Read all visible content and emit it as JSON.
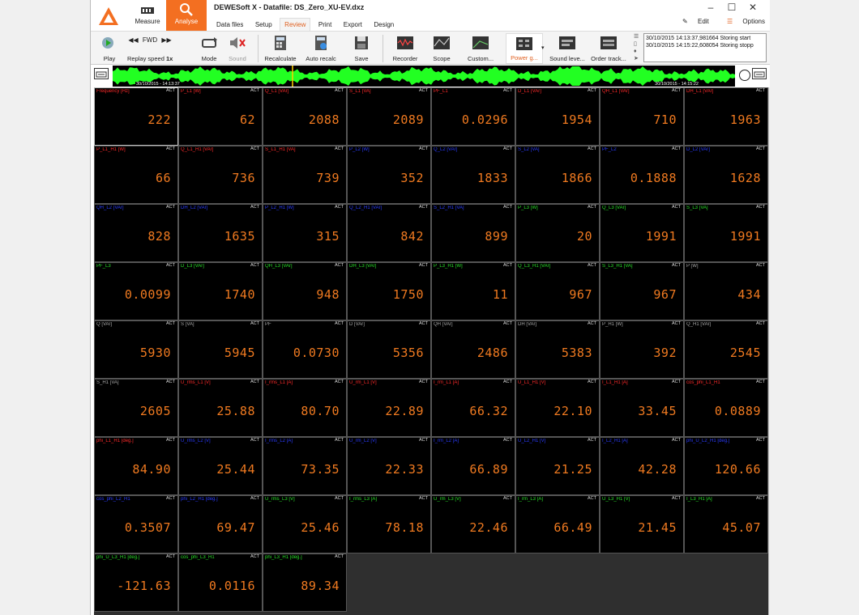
{
  "window": {
    "title": "DEWESoft X - Datafile: DS_Zero_XU-EV.dxz",
    "controls": [
      "–",
      "☐",
      "✕"
    ]
  },
  "modes": [
    {
      "label": "Measure"
    },
    {
      "label": "Analyse"
    }
  ],
  "menu_tabs": [
    "Data files",
    "Setup",
    "Review",
    "Print",
    "Export",
    "Design"
  ],
  "active_tab": "Review",
  "top_right": {
    "edit": "Edit",
    "options": "Options"
  },
  "toolbar": {
    "play": "Play",
    "fwd": "FWD",
    "replay_speed": "Replay speed",
    "replay_speed_value": "1x",
    "mode": "Mode",
    "sound": "Sound",
    "recalculate": "Recalculate",
    "auto_recalc": "Auto recalc",
    "save": "Save",
    "recorder": "Recorder",
    "scope": "Scope",
    "custom": "Custom...",
    "power": "Power g...",
    "sound_level": "Sound leve...",
    "order_tracking": "Order track..."
  },
  "event_log": [
    "30/10/2015 14:13:37,981664 Storing start",
    "30/10/2015 14:15:22,608054 Storing stopp"
  ],
  "overview": {
    "start": "30/10/2015 - 14:13:37",
    "end": "30/10/2015 - 14:15:22"
  },
  "colors": {
    "red": "#ff2a2a",
    "blue": "#2a3cff",
    "green": "#28e028",
    "gray": "#a8a8a8",
    "value": "#f07a20",
    "wave": "#22ff22"
  },
  "badge": "ACT",
  "cells": [
    {
      "name": "Frequency [Hz]",
      "value": "222",
      "color": "red"
    },
    {
      "name": "P_L1 [W]",
      "value": "62",
      "color": "red"
    },
    {
      "name": "Q_L1 [VAr]",
      "value": "2088",
      "color": "red"
    },
    {
      "name": "S_L1 [VA]",
      "value": "2089",
      "color": "red"
    },
    {
      "name": "PF_L1",
      "value": "0.0296",
      "color": "red"
    },
    {
      "name": "D_L1 [VAr]",
      "value": "1954",
      "color": "red"
    },
    {
      "name": "QH_L1 [VAr]",
      "value": "710",
      "color": "red"
    },
    {
      "name": "DH_L1 [VAr]",
      "value": "1963",
      "color": "red"
    },
    {
      "name": "P_L1_H1 [W]",
      "value": "66",
      "color": "red"
    },
    {
      "name": "Q_L1_H1 [VAr]",
      "value": "736",
      "color": "red"
    },
    {
      "name": "S_L1_H1 [VA]",
      "value": "739",
      "color": "red"
    },
    {
      "name": "P_L2 [W]",
      "value": "352",
      "color": "blue"
    },
    {
      "name": "Q_L2 [VAr]",
      "value": "1833",
      "color": "blue"
    },
    {
      "name": "S_L2 [VA]",
      "value": "1866",
      "color": "blue"
    },
    {
      "name": "PF_L2",
      "value": "0.1888",
      "color": "blue"
    },
    {
      "name": "D_L2 [VAr]",
      "value": "1628",
      "color": "blue"
    },
    {
      "name": "QH_L2 [VAr]",
      "value": "828",
      "color": "blue"
    },
    {
      "name": "DH_L2 [VAr]",
      "value": "1635",
      "color": "blue"
    },
    {
      "name": "P_L2_H1 [W]",
      "value": "315",
      "color": "blue"
    },
    {
      "name": "Q_L2_H1 [VAr]",
      "value": "842",
      "color": "blue"
    },
    {
      "name": "S_L2_H1 [VA]",
      "value": "899",
      "color": "blue"
    },
    {
      "name": "P_L3 [W]",
      "value": "20",
      "color": "green"
    },
    {
      "name": "Q_L3 [VAr]",
      "value": "1991",
      "color": "green"
    },
    {
      "name": "S_L3 [VA]",
      "value": "1991",
      "color": "green"
    },
    {
      "name": "PF_L3",
      "value": "0.0099",
      "color": "green"
    },
    {
      "name": "D_L3 [VAr]",
      "value": "1740",
      "color": "green"
    },
    {
      "name": "QH_L3 [VAr]",
      "value": "948",
      "color": "green"
    },
    {
      "name": "DH_L3 [VAr]",
      "value": "1750",
      "color": "green"
    },
    {
      "name": "P_L3_H1 [W]",
      "value": "11",
      "color": "green"
    },
    {
      "name": "Q_L3_H1 [VAr]",
      "value": "967",
      "color": "green"
    },
    {
      "name": "S_L3_H1 [VA]",
      "value": "967",
      "color": "green"
    },
    {
      "name": "P [W]",
      "value": "434",
      "color": "gray"
    },
    {
      "name": "Q [VAr]",
      "value": "5930",
      "color": "gray"
    },
    {
      "name": "S [VA]",
      "value": "5945",
      "color": "gray"
    },
    {
      "name": "PF",
      "value": "0.0730",
      "color": "gray"
    },
    {
      "name": "D [VAr]",
      "value": "5356",
      "color": "gray"
    },
    {
      "name": "QH [VAr]",
      "value": "2486",
      "color": "gray"
    },
    {
      "name": "DH [VAr]",
      "value": "5383",
      "color": "gray"
    },
    {
      "name": "P_H1 [W]",
      "value": "392",
      "color": "gray"
    },
    {
      "name": "Q_H1 [VAr]",
      "value": "2545",
      "color": "gray"
    },
    {
      "name": "S_H1 [VA]",
      "value": "2605",
      "color": "gray"
    },
    {
      "name": "U_rms_L1 [V]",
      "value": "25.88",
      "color": "red"
    },
    {
      "name": "I_rms_L1 [A]",
      "value": "80.70",
      "color": "red"
    },
    {
      "name": "U_rm_L1 [V]",
      "value": "22.89",
      "color": "red"
    },
    {
      "name": "I_rm_L1 [A]",
      "value": "66.32",
      "color": "red"
    },
    {
      "name": "U_L1_H1 [V]",
      "value": "22.10",
      "color": "red"
    },
    {
      "name": "I_L1_H1 [A]",
      "value": "33.45",
      "color": "red"
    },
    {
      "name": "cos_phi_L1_H1",
      "value": "0.0889",
      "color": "red"
    },
    {
      "name": "phi_L1_H1 [deg.]",
      "value": "84.90",
      "color": "red"
    },
    {
      "name": "U_rms_L2 [V]",
      "value": "25.44",
      "color": "blue"
    },
    {
      "name": "I_rms_L2 [A]",
      "value": "73.35",
      "color": "blue"
    },
    {
      "name": "U_rm_L2 [V]",
      "value": "22.33",
      "color": "blue"
    },
    {
      "name": "I_rm_L2 [A]",
      "value": "66.89",
      "color": "blue"
    },
    {
      "name": "U_L2_H1 [V]",
      "value": "21.25",
      "color": "blue"
    },
    {
      "name": "I_L2_H1 [A]",
      "value": "42.28",
      "color": "blue"
    },
    {
      "name": "phi_U_L2_H1 [deg.]",
      "value": "120.66",
      "color": "blue"
    },
    {
      "name": "cos_phi_L2_H1",
      "value": "0.3507",
      "color": "blue"
    },
    {
      "name": "phi_L2_H1 [deg.]",
      "value": "69.47",
      "color": "blue"
    },
    {
      "name": "U_rms_L3 [V]",
      "value": "25.46",
      "color": "green"
    },
    {
      "name": "I_rms_L3 [A]",
      "value": "78.18",
      "color": "green"
    },
    {
      "name": "U_rm_L3 [V]",
      "value": "22.46",
      "color": "green"
    },
    {
      "name": "I_rm_L3 [A]",
      "value": "66.49",
      "color": "green"
    },
    {
      "name": "U_L3_H1 [V]",
      "value": "21.45",
      "color": "green"
    },
    {
      "name": "I_L3_H1 [A]",
      "value": "45.07",
      "color": "green"
    },
    {
      "name": "phi_U_L3_H1 [deg.]",
      "value": "-121.63",
      "color": "green"
    },
    {
      "name": "cos_phi_L3_H1",
      "value": "0.0116",
      "color": "green"
    },
    {
      "name": "phi_L3_H1 [deg.]",
      "value": "89.34",
      "color": "green"
    }
  ]
}
